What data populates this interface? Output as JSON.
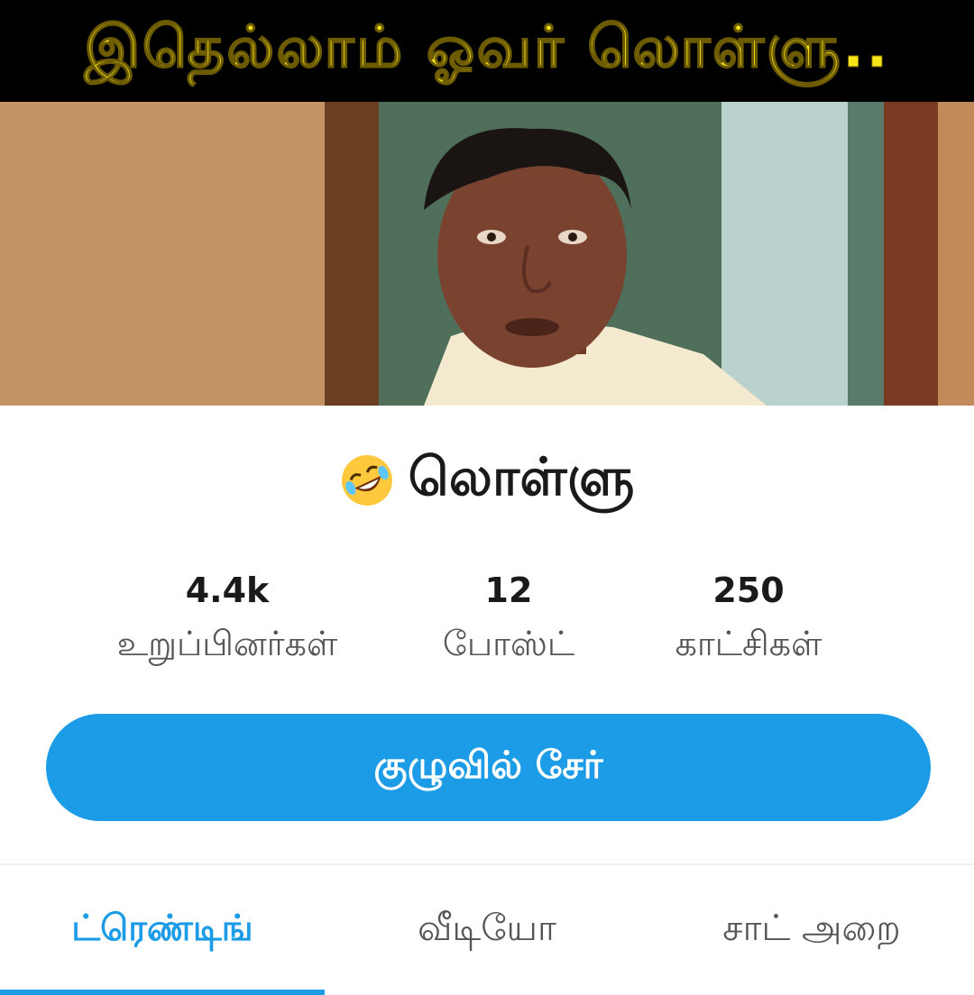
{
  "cover": {
    "caption": "இதெல்லாம் ஓவர் லொள்ளு..",
    "caption_color": "#f7e51a"
  },
  "community": {
    "emoji_icon": "rolling-on-floor-laughing-icon",
    "name": "லொள்ளு"
  },
  "stats": [
    {
      "value": "4.4k",
      "label": "உறுப்பினர்கள்"
    },
    {
      "value": "12",
      "label": "போஸ்ட்"
    },
    {
      "value": "250",
      "label": "காட்சிகள்"
    }
  ],
  "join_button": {
    "label": "குழுவில் சேர்",
    "color": "#1c9be6"
  },
  "tabs": [
    {
      "label": "ட்ரெண்டிங்",
      "active": true
    },
    {
      "label": "வீடியோ",
      "active": false
    },
    {
      "label": "சாட் அறை",
      "active": false
    }
  ],
  "accent_color": "#1c9be6"
}
